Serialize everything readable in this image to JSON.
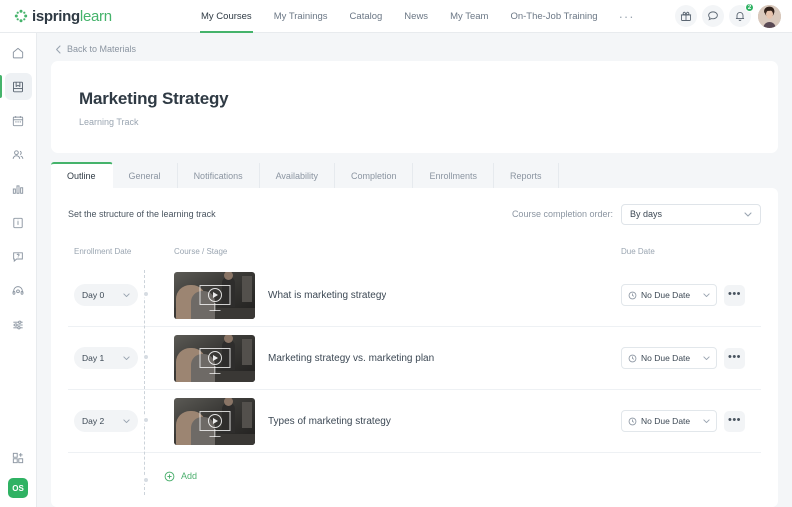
{
  "brand": {
    "name_part1": "ispring",
    "name_part2": "learn",
    "accent": "#45b36b",
    "green": "#2fb263"
  },
  "topnav": {
    "items": [
      {
        "label": "My Courses",
        "active": true
      },
      {
        "label": "My Trainings",
        "active": false
      },
      {
        "label": "Catalog",
        "active": false
      },
      {
        "label": "News",
        "active": false
      },
      {
        "label": "My Team",
        "active": false
      },
      {
        "label": "On-The-Job Training",
        "active": false
      }
    ],
    "more_label": "···",
    "icons": [
      {
        "name": "gift-icon"
      },
      {
        "name": "chat-icon"
      },
      {
        "name": "bell-icon",
        "badge": "2"
      }
    ]
  },
  "sidebar": {
    "items": [
      {
        "name": "home-icon",
        "active": false
      },
      {
        "name": "book-icon",
        "active": true
      },
      {
        "name": "calendar-icon",
        "active": false
      },
      {
        "name": "users-icon",
        "active": false
      },
      {
        "name": "chart-icon",
        "active": false
      },
      {
        "name": "info-icon",
        "active": false
      },
      {
        "name": "chat-question-icon",
        "active": false
      },
      {
        "name": "support-icon",
        "active": false
      },
      {
        "name": "sliders-icon",
        "active": false
      }
    ],
    "add_app_icon": "add-apps-icon",
    "org_badge": "OS"
  },
  "breadcrumb": {
    "back_label": "Back to Materials"
  },
  "header": {
    "title": "Marketing Strategy",
    "subtitle": "Learning Track"
  },
  "tabs": [
    {
      "label": "Outline",
      "active": true
    },
    {
      "label": "General",
      "active": false
    },
    {
      "label": "Notifications",
      "active": false
    },
    {
      "label": "Availability",
      "active": false
    },
    {
      "label": "Completion",
      "active": false
    },
    {
      "label": "Enrollments",
      "active": false
    },
    {
      "label": "Reports",
      "active": false
    }
  ],
  "panel": {
    "title": "Set the structure of the learning track",
    "order_label": "Course completion order:",
    "order_value": "By days",
    "columns": {
      "enrollment_date": "Enrollment Date",
      "course_stage": "Course / Stage",
      "due_date": "Due Date"
    },
    "rows": [
      {
        "day": "Day 0",
        "title": "What is marketing strategy",
        "due": "No Due Date",
        "menu": "•••"
      },
      {
        "day": "Day 1",
        "title": "Marketing strategy vs. marketing plan",
        "due": "No Due Date",
        "menu": "•••"
      },
      {
        "day": "Day 2",
        "title": "Types of marketing strategy",
        "due": "No Due Date",
        "menu": "•••"
      }
    ],
    "add_label": "Add"
  }
}
